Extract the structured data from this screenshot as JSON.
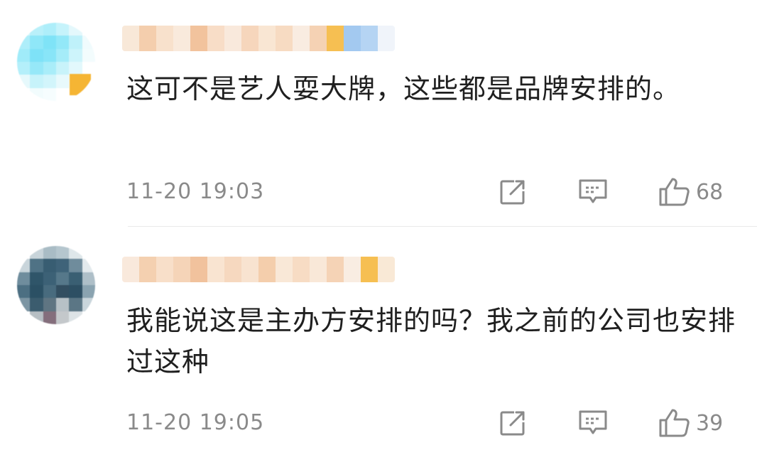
{
  "comments": [
    {
      "text": "这可不是艺人耍大牌，这些都是品牌安排的。",
      "time": "11-20 19:03",
      "likes": "68",
      "share_icon": "share-icon",
      "reply_icon": "comment-icon",
      "like_icon": "thumbs-up-icon"
    },
    {
      "text": "我能说这是主办方安排的吗？我之前的公司也安排过这种",
      "time": "11-20 19:05",
      "likes": "39",
      "share_icon": "share-icon",
      "reply_icon": "comment-icon",
      "like_icon": "thumbs-up-icon"
    }
  ],
  "colors": {
    "text": "#1f1f1f",
    "meta": "#8a8a8a",
    "icon": "#8a8a8a",
    "divider": "#e9e9e9",
    "avatar1": "#9ee6f7",
    "avatar2": "#4a6d80",
    "username_blur": "#f5c9a8"
  }
}
